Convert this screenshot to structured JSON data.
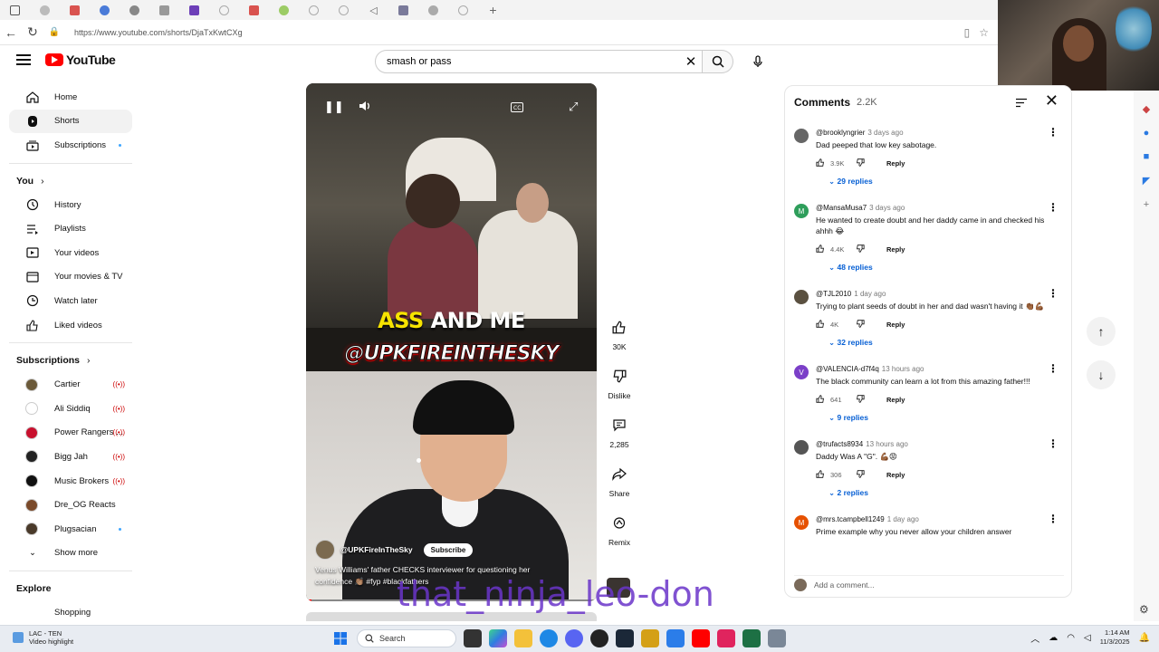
{
  "browser": {
    "url": "https://www.youtube.com/shorts/DjaTxKwtCXg",
    "tab_count": 16
  },
  "header": {
    "logo_text": "YouTube",
    "search_value": "smash or pass"
  },
  "sidebar": {
    "main": [
      {
        "label": "Home",
        "icon": "home-icon"
      },
      {
        "label": "Shorts",
        "icon": "shorts-icon",
        "active": true
      },
      {
        "label": "Subscriptions",
        "icon": "subscriptions-icon",
        "dot": true
      }
    ],
    "you_heading": "You",
    "you_items": [
      {
        "label": "History",
        "icon": "history-icon"
      },
      {
        "label": "Playlists",
        "icon": "playlists-icon"
      },
      {
        "label": "Your videos",
        "icon": "your-videos-icon"
      },
      {
        "label": "Your movies & TV",
        "icon": "movies-icon"
      },
      {
        "label": "Watch later",
        "icon": "clock-icon"
      },
      {
        "label": "Liked videos",
        "icon": "thumbs-up-icon"
      }
    ],
    "subscriptions_heading": "Subscriptions",
    "subscriptions": [
      {
        "label": "Cartier",
        "color": "#6b5a3a",
        "live": true
      },
      {
        "label": "Ali Siddiq",
        "color": "#ffffff",
        "live": true
      },
      {
        "label": "Power Rangers ...",
        "color": "#c8102e",
        "live": true
      },
      {
        "label": "Bigg Jah",
        "color": "#222222",
        "live": true
      },
      {
        "label": "Music Brokers",
        "color": "#111111",
        "live": true
      },
      {
        "label": "Dre_OG Reacts",
        "color": "#7a4a2a",
        "live": false
      },
      {
        "label": "Plugsacian",
        "color": "#4a3a2a",
        "dot": true
      }
    ],
    "show_more": "Show more",
    "explore_heading": "Explore",
    "explore_partial": "Shopping"
  },
  "video": {
    "caption_top_yellow": "ASS",
    "caption_top_white": "AND ME",
    "caption_handle": "@UPKFIREINTHESKY",
    "channel_name": "@UPKFireInTheSky",
    "subscribe_label": "Subscribe",
    "description": "Venus Williams' father CHECKS interviewer for questioning her confidence 👏🏽 #fyp #blackfathers",
    "progress": 0.02
  },
  "actions": [
    {
      "icon": "like-icon",
      "label": "30K"
    },
    {
      "icon": "dislike-icon",
      "label": "Dislike"
    },
    {
      "icon": "comment-icon",
      "label": "2,285"
    },
    {
      "icon": "share-icon",
      "label": "Share"
    },
    {
      "icon": "remix-icon",
      "label": "Remix"
    }
  ],
  "watermark": "that_ninja_leo-don",
  "comments": {
    "title": "Comments",
    "count": "2.2K",
    "add_placeholder": "Add a comment...",
    "items": [
      {
        "author": "@brooklyngrier",
        "ago": "3 days ago",
        "text": "Dad peeped that low key sabotage.",
        "likes": "3.9K",
        "replies": "29 replies",
        "avatar_color": "#666666",
        "avatar_letter": ""
      },
      {
        "author": "@MansaMusa7",
        "ago": "3 days ago",
        "text": "He wanted to create doubt and her daddy came in and checked his ahhh 😂",
        "likes": "4.4K",
        "replies": "48 replies",
        "avatar_color": "#2e9e5b",
        "avatar_letter": "M"
      },
      {
        "author": "@TJL2010",
        "ago": "1 day ago",
        "text": "Trying to plant seeds of doubt in her and dad wasn't having it 👏🏾💪🏾",
        "likes": "4K",
        "replies": "32 replies",
        "avatar_color": "#5a5040",
        "avatar_letter": ""
      },
      {
        "author": "@VALENCIA-d7f4q",
        "ago": "13 hours ago",
        "text": "The black community can learn a lot from this amazing father!!!",
        "likes": "641",
        "replies": "9 replies",
        "avatar_color": "#7b3fc8",
        "avatar_letter": "V"
      },
      {
        "author": "@trufacts8934",
        "ago": "13 hours ago",
        "text": "Daddy Was A \"G\". 💪🏾😡",
        "likes": "306",
        "replies": "2 replies",
        "avatar_color": "#555555",
        "avatar_letter": ""
      },
      {
        "author": "@mrs.tcampbell1249",
        "ago": "1 day ago",
        "text": "Prime example why you never allow your children answer",
        "likes": "",
        "replies": "",
        "avatar_color": "#e65100",
        "avatar_letter": "M"
      }
    ],
    "reply_label": "Reply"
  },
  "taskbar": {
    "weather_temp": "LAC - TEN",
    "weather_desc": "Video highlight",
    "search_label": "Search",
    "time": "1:14 AM",
    "date": "11/3/2025"
  }
}
